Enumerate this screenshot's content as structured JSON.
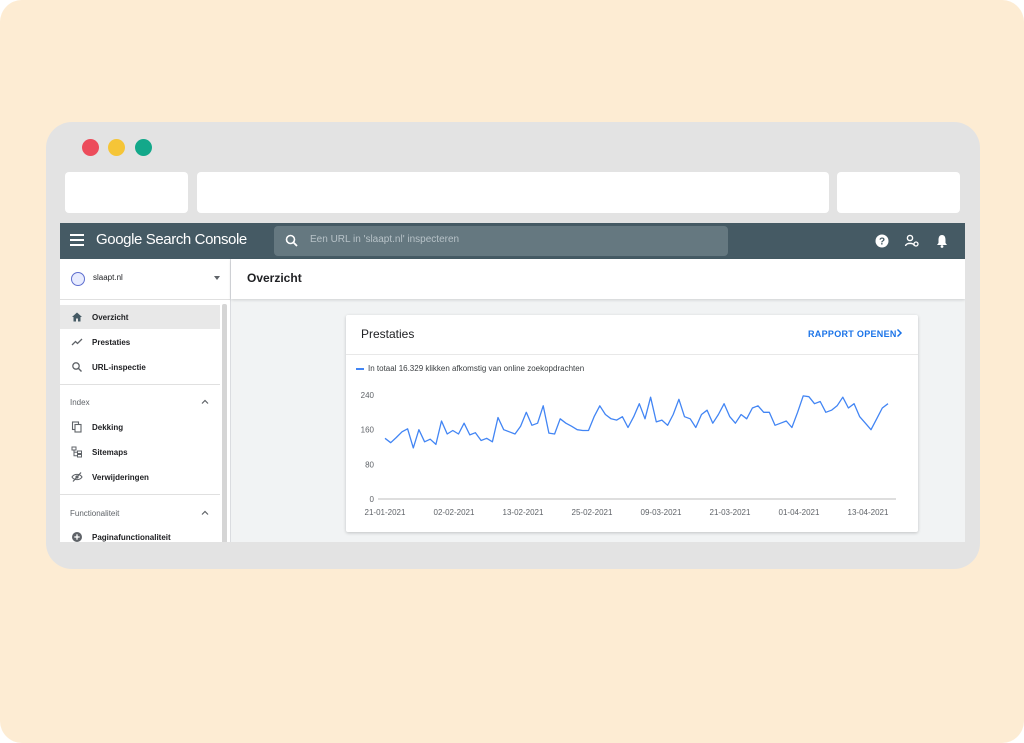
{
  "app": {
    "logo": "Google Search Console",
    "search_placeholder": "Een URL in 'slaapt.nl' inspecteren"
  },
  "topbar_icons": [
    "menu-icon",
    "search-icon",
    "help-icon",
    "users-icon",
    "bell-icon"
  ],
  "sidebar": {
    "property": "slaapt.nl",
    "items": [
      {
        "label": "Overzicht",
        "icon": "home-icon",
        "active": true
      },
      {
        "label": "Prestaties",
        "icon": "trending-icon"
      },
      {
        "label": "URL-inspectie",
        "icon": "search-icon"
      }
    ],
    "sections": [
      {
        "label": "Index",
        "items": [
          {
            "label": "Dekking",
            "icon": "copy-icon"
          },
          {
            "label": "Sitemaps",
            "icon": "sitemap-icon"
          },
          {
            "label": "Verwijderingen",
            "icon": "eye-off-icon"
          }
        ]
      },
      {
        "label": "Functionaliteit",
        "items": [
          {
            "label": "Paginafunctionaliteit",
            "icon": "plus-circle-icon"
          }
        ]
      }
    ]
  },
  "main": {
    "title": "Overzicht",
    "card": {
      "title": "Prestaties",
      "link": "RAPPORT OPENEN",
      "legend": "In totaal 16.329 klikken afkomstig van online zoekopdrachten"
    }
  },
  "colors": {
    "topbar": "#455a64",
    "accent": "#1a73e8",
    "line": "#4285f4",
    "background": "#fdecd3"
  },
  "chart_data": {
    "type": "line",
    "title": "",
    "xlabel": "",
    "ylabel": "",
    "ylim": [
      0,
      240
    ],
    "yticks": [
      0,
      80,
      160,
      240
    ],
    "x_tick_labels": [
      "21-01-2021",
      "02-02-2021",
      "13-02-2021",
      "25-02-2021",
      "09-03-2021",
      "21-03-2021",
      "01-04-2021",
      "13-04-2021"
    ],
    "series": [
      {
        "name": "",
        "values": [
          140,
          130,
          142,
          155,
          162,
          118,
          160,
          132,
          138,
          126,
          180,
          150,
          158,
          150,
          175,
          148,
          153,
          135,
          140,
          132,
          188,
          160,
          155,
          150,
          168,
          200,
          170,
          175,
          215,
          152,
          150,
          185,
          175,
          168,
          160,
          158,
          158,
          190,
          215,
          195,
          185,
          182,
          190,
          165,
          190,
          220,
          185,
          235,
          178,
          182,
          170,
          195,
          230,
          190,
          185,
          165,
          195,
          205,
          175,
          195,
          220,
          190,
          175,
          195,
          185,
          210,
          215,
          200,
          200,
          170,
          175,
          180,
          165,
          200,
          238,
          236,
          220,
          225,
          200,
          205,
          215,
          235,
          210,
          220,
          190,
          175,
          160,
          185,
          210,
          220
        ]
      }
    ],
    "grid": false,
    "legend_position": "top-left"
  }
}
